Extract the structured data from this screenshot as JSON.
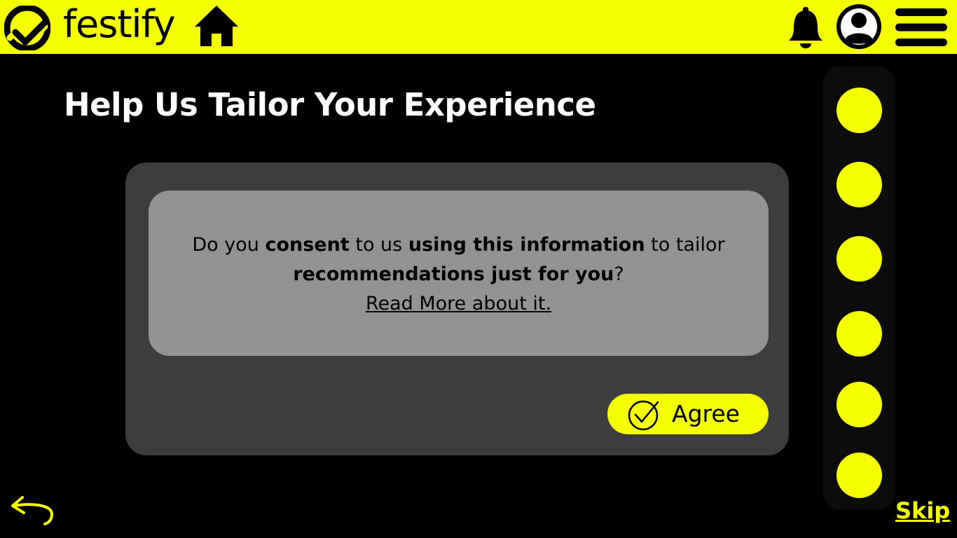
{
  "header": {
    "brand": "festify",
    "icons": [
      "festify-logo-icon",
      "home-icon",
      "bell-icon",
      "user-avatar-icon",
      "menu-icon"
    ]
  },
  "page": {
    "title": "Help Us Tailor Your Experience"
  },
  "consent": {
    "line1_a": "Do you ",
    "line1_b": "consent",
    "line1_c": " to us ",
    "line1_d": "using this information",
    "line1_e": " to tailor",
    "line2_a": "recommendations just for you",
    "line2_b": "?",
    "read_more": "Read More about it."
  },
  "actions": {
    "agree_label": "Agree",
    "skip_label": "Skip"
  },
  "steps": {
    "count": 6
  },
  "colors": {
    "accent": "#f4ff00",
    "background": "#000000",
    "card": "#3d3d3d",
    "consent_box": "#939393"
  }
}
